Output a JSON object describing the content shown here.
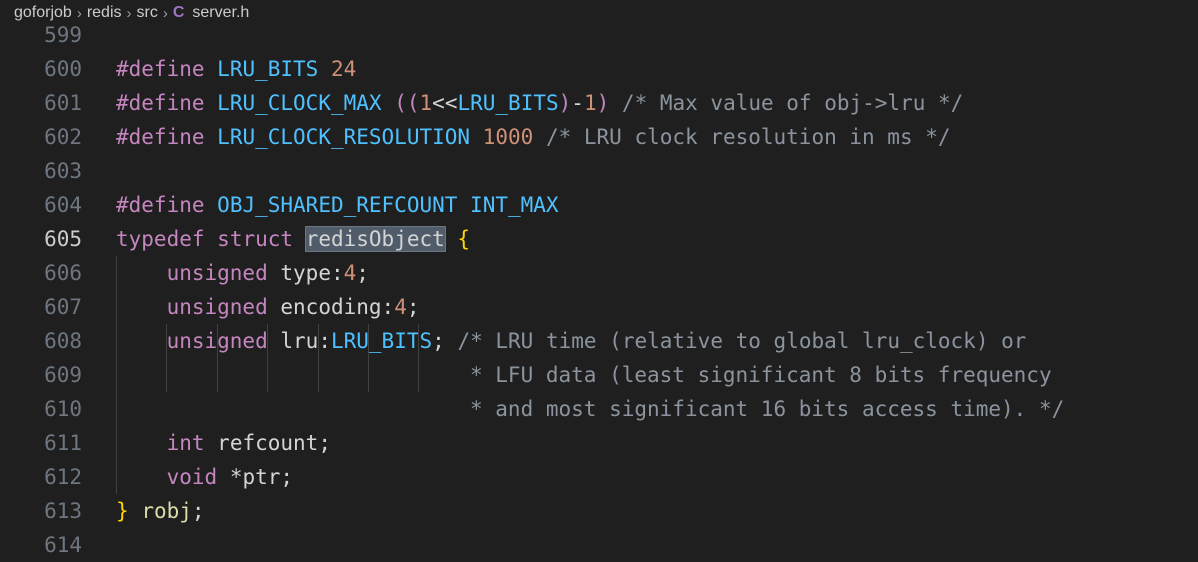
{
  "breadcrumb": {
    "items": [
      "goforjob",
      "redis",
      "src"
    ],
    "file_icon": "C",
    "file": "server.h"
  },
  "lines": [
    {
      "n": "599",
      "code": ""
    },
    {
      "n": "600",
      "code": "#define LRU_BITS 24"
    },
    {
      "n": "601",
      "code": "#define LRU_CLOCK_MAX ((1<<LRU_BITS)-1) /* Max value of obj->lru */"
    },
    {
      "n": "602",
      "code": "#define LRU_CLOCK_RESOLUTION 1000 /* LRU clock resolution in ms */"
    },
    {
      "n": "603",
      "code": ""
    },
    {
      "n": "604",
      "code": "#define OBJ_SHARED_REFCOUNT INT_MAX"
    },
    {
      "n": "605",
      "code": "typedef struct redisObject {"
    },
    {
      "n": "606",
      "code": "    unsigned type:4;"
    },
    {
      "n": "607",
      "code": "    unsigned encoding:4;"
    },
    {
      "n": "608",
      "code": "    unsigned lru:LRU_BITS; /* LRU time (relative to global lru_clock) or"
    },
    {
      "n": "609",
      "code": "                            * LFU data (least significant 8 bits frequency"
    },
    {
      "n": "610",
      "code": "                            * and most significant 16 bits access time). */"
    },
    {
      "n": "611",
      "code": "    int refcount;"
    },
    {
      "n": "612",
      "code": "    void *ptr;"
    },
    {
      "n": "613",
      "code": "} robj;"
    },
    {
      "n": "614",
      "code": ""
    }
  ],
  "active_line": "605",
  "highlight_word": "redisObject"
}
